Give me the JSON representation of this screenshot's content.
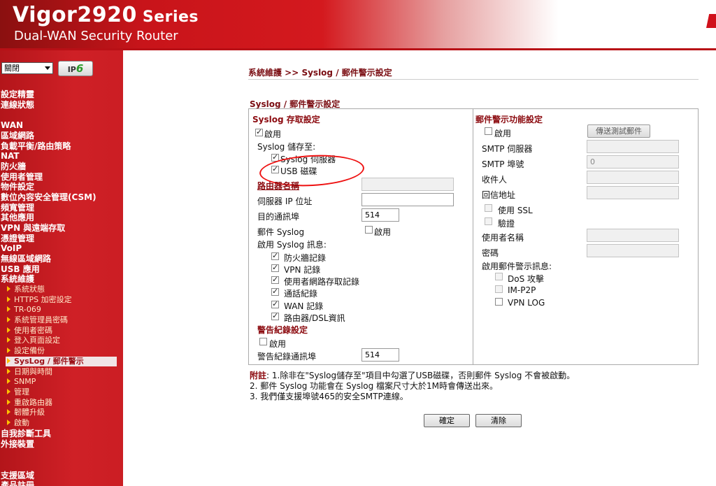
{
  "header": {
    "brand": "Vigor2920",
    "series": "Series",
    "subtitle": "Dual-WAN Security Router"
  },
  "sidebar": {
    "select_value": "關閉",
    "ipv6_label": "IP",
    "ipv6_suffix": "6",
    "items": [
      "設定精靈",
      "連線狀態",
      "WAN",
      "區域網路",
      "負載平衡/路由策略",
      "NAT",
      "防火牆",
      "使用者管理",
      "物件設定",
      "數位內容安全管理(CSM)",
      "頻寬管理",
      "其他應用",
      "VPN 與遠端存取",
      "憑證管理",
      "VoIP",
      "無線區域網路",
      "USB 應用",
      "系統維護"
    ],
    "sub_items": [
      "系統狀態",
      "HTTPS 加密設定",
      "TR-069",
      "系統管理員密碼",
      "使用者密碼",
      "登入頁面設定",
      "設定備份",
      "SysLog / 郵件警示",
      "日期與時間",
      "SNMP",
      "管理",
      "重啟路由器",
      "韌體升級",
      "啟動"
    ],
    "bottom_items": [
      "自我診斷工具",
      "外接裝置",
      "支援區域",
      "產品註冊"
    ]
  },
  "main": {
    "breadcrumb": "系統維護 >> Syslog / 郵件警示設定",
    "section_title": "Syslog / 郵件警示設定",
    "syslog": {
      "heading": "Syslog 存取設定",
      "enable": "啟用",
      "save_to": "Syslog 儲存至:",
      "syslog_server": "Syslog 伺服器",
      "usb_disk": "USB 磁碟",
      "router_name": "路由器名稱",
      "server_ip": "伺服器 IP 位址",
      "dest_port": "目的通訊埠",
      "dest_port_value": "514",
      "mail_syslog": "郵件 Syslog",
      "mail_enable": "啟用",
      "enable_msgs": "啟用 Syslog 訊息:",
      "messages": [
        "防火牆記錄",
        "VPN 記錄",
        "使用者網路存取記錄",
        "通話紀錄",
        "WAN 記錄",
        "路由器/DSL資訊"
      ]
    },
    "alert_log": {
      "heading": "警告紀錄設定",
      "enable": "啟用",
      "port_label": "警告紀錄通訊埠",
      "port_value": "514"
    },
    "mail": {
      "heading": "郵件警示功能設定",
      "enable": "啟用",
      "test_button": "傳送測試郵件",
      "smtp_server": "SMTP 伺服器",
      "smtp_port": "SMTP 埠號",
      "smtp_port_value": "0",
      "recipient": "收件人",
      "reply_to": "回信地址",
      "use_ssl": "使用 SSL",
      "auth": "驗證",
      "username": "使用者名稱",
      "password": "密碼",
      "enable_alerts": "啟用郵件警示訊息:",
      "alerts": [
        "DoS 攻擊",
        "IM-P2P",
        "VPN LOG"
      ]
    },
    "notes": {
      "label": "附註",
      "line1": ": 1.除非在\"Syslog儲存至\"項目中勾選了USB磁碟，否則郵件 Syslog 不會被啟動。",
      "line2": "2. 郵件 Syslog 功能會在 Syslog 檔案尺寸大於1M時會傳送出來。",
      "line3": "3. 我們僅支援埠號465的安全SMTP連線。"
    },
    "buttons": {
      "ok": "確定",
      "clear": "清除"
    }
  }
}
